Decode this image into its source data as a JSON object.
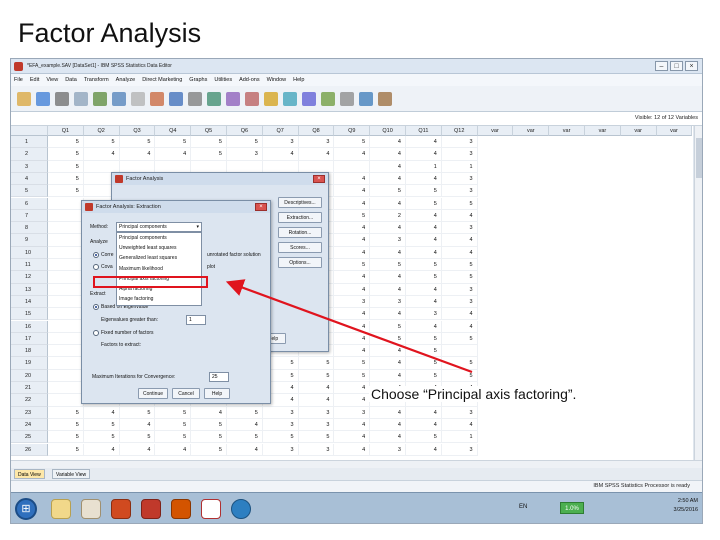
{
  "slide": {
    "title": "Factor Analysis",
    "callout": "Choose “Principal axis factoring”."
  },
  "window": {
    "title": "*EFA_example.SAV [DataSet1] - IBM SPSS Statistics Data Editor",
    "buttons": [
      "–",
      "□",
      "×"
    ]
  },
  "menu": [
    "File",
    "Edit",
    "View",
    "Data",
    "Transform",
    "Analyze",
    "Direct Marketing",
    "Graphs",
    "Utilities",
    "Add-ons",
    "Window",
    "Help"
  ],
  "visible_label": "Visible: 12 of 12 Variables",
  "columns": [
    "Q1",
    "Q2",
    "Q3",
    "Q4",
    "Q5",
    "Q6",
    "Q7",
    "Q8",
    "Q9",
    "Q10",
    "Q11",
    "Q12",
    "var",
    "var",
    "var",
    "var",
    "var",
    "var"
  ],
  "rows": [
    {
      "n": "1",
      "v": [
        "5",
        "5",
        "5",
        "5",
        "5",
        "5",
        "3",
        "3",
        "5",
        "4",
        "4",
        "3"
      ]
    },
    {
      "n": "2",
      "v": [
        "5",
        "4",
        "4",
        "4",
        "5",
        "3",
        "4",
        "4",
        "4",
        "4",
        "4",
        "3"
      ]
    },
    {
      "n": "3",
      "v": [
        "5",
        "",
        "",
        "",
        "",
        "",
        "",
        "",
        "",
        "4",
        "1",
        "1"
      ]
    },
    {
      "n": "4",
      "v": [
        "5",
        "",
        "",
        "",
        "",
        "",
        "",
        "",
        "4",
        "4",
        "4",
        "3"
      ]
    },
    {
      "n": "5",
      "v": [
        "5",
        "",
        "",
        "",
        "",
        "",
        "",
        "",
        "4",
        "5",
        "5",
        "3"
      ]
    },
    {
      "n": "6",
      "v": [
        "",
        "",
        "",
        "",
        "",
        "",
        "",
        "",
        "4",
        "4",
        "5",
        "5"
      ]
    },
    {
      "n": "7",
      "v": [
        "",
        "",
        "",
        "",
        "",
        "",
        "",
        "",
        "5",
        "2",
        "4",
        "4"
      ]
    },
    {
      "n": "8",
      "v": [
        "",
        "",
        "",
        "",
        "",
        "",
        "",
        "",
        "4",
        "4",
        "4",
        "3"
      ]
    },
    {
      "n": "9",
      "v": [
        "",
        "",
        "",
        "",
        "",
        "",
        "",
        "",
        "4",
        "3",
        "4",
        "4"
      ]
    },
    {
      "n": "10",
      "v": [
        "",
        "",
        "",
        "",
        "",
        "",
        "",
        "",
        "4",
        "4",
        "4",
        "4"
      ]
    },
    {
      "n": "11",
      "v": [
        "",
        "",
        "",
        "",
        "",
        "",
        "",
        "",
        "5",
        "5",
        "5",
        "5"
      ]
    },
    {
      "n": "12",
      "v": [
        "",
        "",
        "",
        "",
        "",
        "",
        "",
        "",
        "4",
        "4",
        "5",
        "5"
      ]
    },
    {
      "n": "13",
      "v": [
        "",
        "",
        "",
        "",
        "",
        "",
        "",
        "",
        "4",
        "4",
        "4",
        "3"
      ]
    },
    {
      "n": "14",
      "v": [
        "",
        "",
        "",
        "",
        "",
        "",
        "",
        "",
        "3",
        "3",
        "4",
        "3"
      ]
    },
    {
      "n": "15",
      "v": [
        "",
        "",
        "",
        "",
        "",
        "",
        "",
        "",
        "4",
        "4",
        "3",
        "4"
      ]
    },
    {
      "n": "16",
      "v": [
        "",
        "",
        "",
        "",
        "",
        "",
        "",
        "",
        "4",
        "5",
        "4",
        "4"
      ]
    },
    {
      "n": "17",
      "v": [
        "",
        "",
        "",
        "",
        "",
        "",
        "",
        "",
        "4",
        "5",
        "5",
        "5"
      ]
    },
    {
      "n": "18",
      "v": [
        "",
        "",
        "",
        "",
        "",
        "",
        "",
        "",
        "4",
        "4",
        "5",
        ""
      ]
    },
    {
      "n": "19",
      "v": [
        "",
        "",
        "",
        "",
        "",
        "",
        "5",
        "5",
        "5",
        "4",
        "5",
        "5"
      ]
    },
    {
      "n": "20",
      "v": [
        "",
        "",
        "",
        "",
        "",
        "",
        "5",
        "5",
        "5",
        "4",
        "5",
        "5"
      ]
    },
    {
      "n": "21",
      "v": [
        "",
        "",
        "",
        "",
        "",
        "",
        "4",
        "4",
        "4",
        "4",
        "4",
        "4"
      ]
    },
    {
      "n": "22",
      "v": [
        "",
        "",
        "",
        "",
        "",
        "",
        "4",
        "4",
        "4",
        "4",
        "4",
        "4"
      ]
    },
    {
      "n": "23",
      "v": [
        "5",
        "4",
        "5",
        "5",
        "4",
        "5",
        "3",
        "3",
        "3",
        "4",
        "4",
        "3"
      ]
    },
    {
      "n": "24",
      "v": [
        "5",
        "5",
        "4",
        "5",
        "5",
        "4",
        "3",
        "3",
        "4",
        "4",
        "4",
        "4"
      ]
    },
    {
      "n": "25",
      "v": [
        "5",
        "5",
        "5",
        "5",
        "5",
        "5",
        "5",
        "5",
        "4",
        "4",
        "5",
        "1"
      ]
    },
    {
      "n": "26",
      "v": [
        "5",
        "4",
        "4",
        "4",
        "5",
        "4",
        "3",
        "3",
        "4",
        "3",
        "4",
        "3"
      ]
    }
  ],
  "tabs": {
    "data_view": "Data View",
    "variable_view": "Variable View"
  },
  "status": "IBM SPSS Statistics Processor is ready",
  "taskbar": {
    "lang": "EN",
    "badge": "1.0%",
    "time": "2:50 AM",
    "date": "3/25/2016"
  },
  "factor_dialog": {
    "title": "Factor Analysis",
    "buttons": [
      "Descriptives...",
      "Extraction...",
      "Rotation...",
      "Scores...",
      "Options..."
    ],
    "help": "Help"
  },
  "extraction_dialog": {
    "title": "Factor Analysis: Extraction",
    "method_label": "Method:",
    "method_value": "Principal components",
    "methods": [
      "Principal components",
      "Unweighted least squares",
      "Generalized least squares",
      "Maximum likelihood",
      "Principal axis factoring",
      "Alpha factoring",
      "Image factoring"
    ],
    "highlighted": "Principal axis factoring",
    "analyze_label": "Analyze",
    "opt_corr": "Corre",
    "opt_cov": "Cova",
    "display_label": "unrotated factor solution",
    "scree_label": "plot",
    "extract_label": "Extract",
    "based_label": "Based on Eigenvalue",
    "eigen_label": "Eigenvalues greater than:",
    "eigen_value": "1",
    "fixed_label": "Fixed number of factors",
    "factors_label": "Factors to extract:",
    "max_iter_label": "Maximum Iterations for Convergence:",
    "max_iter_value": "25",
    "continue": "Continue",
    "cancel": "Cancel",
    "help": "Help"
  }
}
